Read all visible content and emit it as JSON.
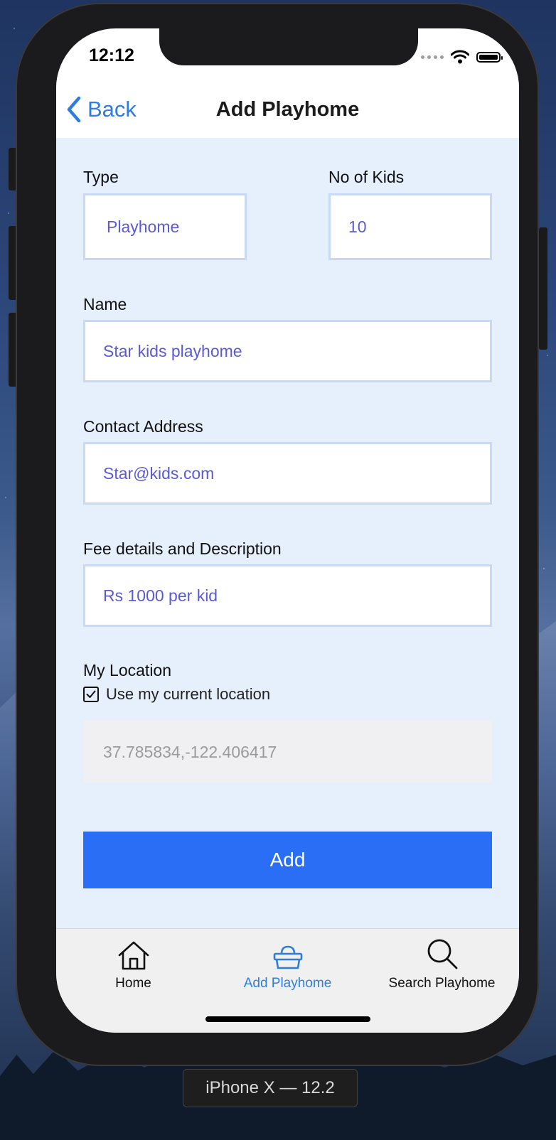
{
  "status_bar": {
    "time": "12:12"
  },
  "nav": {
    "back_label": "Back",
    "title": "Add Playhome"
  },
  "form": {
    "type_label": "Type",
    "type_value": "Playhome",
    "kids_label": "No of Kids",
    "kids_value": "10",
    "name_label": "Name",
    "name_value": "Star kids playhome",
    "contact_label": "Contact Address",
    "contact_value": "Star@kids.com",
    "fee_label": "Fee details and Description",
    "fee_value": "Rs 1000 per kid",
    "location_label": "My Location",
    "use_location_label": "Use my current location",
    "use_location_checked": true,
    "location_value": "37.785834,-122.406417",
    "add_button_label": "Add"
  },
  "tabbar": {
    "tabs": [
      {
        "label": "Home",
        "icon": "home-icon",
        "active": false
      },
      {
        "label": "Add Playhome",
        "icon": "basket-icon",
        "active": true
      },
      {
        "label": "Search Playhome",
        "icon": "search-icon",
        "active": false
      }
    ]
  },
  "simulator": {
    "device_label": "iPhone X — 12.2"
  },
  "colors": {
    "accent": "#2f7de1",
    "primary_button": "#2a6ef5",
    "field_text": "#5a5bd4",
    "form_background": "#e6effc"
  }
}
